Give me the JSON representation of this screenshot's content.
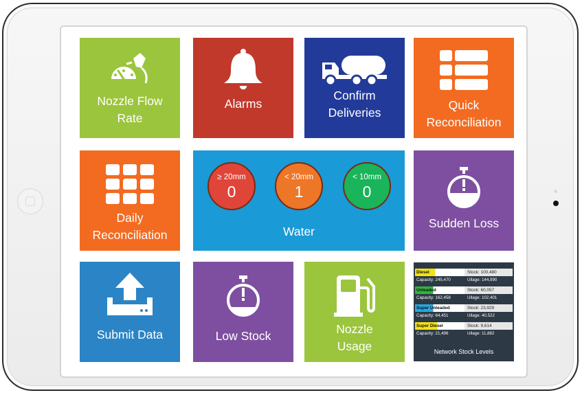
{
  "tiles": {
    "nozzle_flow_rate": {
      "line1": "Nozzle Flow",
      "line2": "Rate",
      "color": "#9bc53d"
    },
    "alarms": {
      "label": "Alarms",
      "color": "#c0392b"
    },
    "confirm_deliveries": {
      "line1": "Confirm",
      "line2": "Deliveries",
      "color": "#223b9a"
    },
    "quick_reconciliation": {
      "line1": "Quick",
      "line2": "Reconciliation",
      "color": "#f26b21"
    },
    "daily_reconciliation": {
      "line1": "Daily",
      "line2": "Reconciliation",
      "color": "#f26b21"
    },
    "water": {
      "label": "Water",
      "color": "#1a9ad6",
      "levels": [
        {
          "label": "≥ 20mm",
          "value": "0",
          "color": "#e0453a"
        },
        {
          "label": "< 20mm",
          "value": "1",
          "color": "#ee7627"
        },
        {
          "label": "< 10mm",
          "value": "0",
          "color": "#1ab45a"
        }
      ]
    },
    "sudden_loss": {
      "label": "Sudden Loss",
      "color": "#7e4fa0"
    },
    "submit_data": {
      "label": "Submit Data",
      "color": "#2b84c6"
    },
    "low_stock": {
      "label": "Low Stock",
      "color": "#7e4fa0"
    },
    "nozzle_usage": {
      "line1": "Nozzle",
      "line2": "Usage",
      "color": "#9bc53d"
    }
  },
  "network_stock": {
    "title": "Network Stock Levels",
    "products": [
      {
        "name": "Diesel",
        "stock": "Stock: 100,480",
        "capacity": "Capacity: 245,470",
        "ullage": "Ullage: 144,990",
        "fill": 0.41,
        "color": "#f2e313"
      },
      {
        "name": "Unleaded",
        "stock": "Stock: 60,057",
        "capacity": "Capacity: 162,458",
        "ullage": "Ullage: 102,401",
        "fill": 0.37,
        "color": "#2fb53d"
      },
      {
        "name": "Super Unleaded",
        "stock": "Stock: 23,929",
        "capacity": "Capacity: 64,451",
        "ullage": "Ullage: 40,522",
        "fill": 0.37,
        "color": "#27a9e1"
      },
      {
        "name": "Super Diesel",
        "stock": "Stock: 9,614",
        "capacity": "Capacity: 21,496",
        "ullage": "Ullage: 11,882",
        "fill": 0.45,
        "color": "#f2e313"
      }
    ]
  },
  "icons": [
    "fuel-gauge-nozzle-icon",
    "bell-icon",
    "tanker-truck-icon",
    "list-icon",
    "grid-icon",
    "stopwatch-icon",
    "upload-icon",
    "stopwatch-icon",
    "fuel-pump-icon"
  ]
}
